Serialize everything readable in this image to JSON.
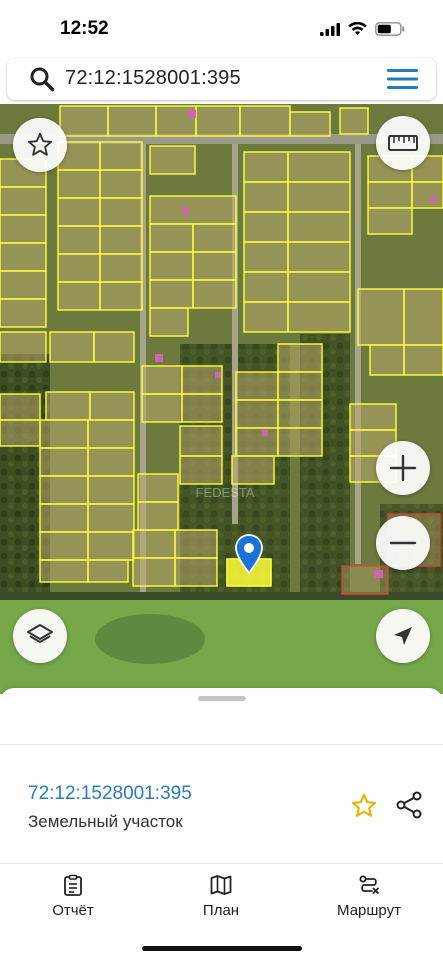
{
  "status": {
    "time": "12:52"
  },
  "search": {
    "query": "72:12:1528001:395"
  },
  "map": {
    "watermark": "FEDESTA",
    "accent": "#1a73d8",
    "parcel_outline": "#ffff3a",
    "buttons": {
      "favorite": "star-outline-icon",
      "ruler": "ruler-icon",
      "zoom_in": "plus-icon",
      "zoom_out": "minus-icon",
      "layers": "layers-icon",
      "locate": "location-arrow-icon"
    }
  },
  "sheet": {
    "parcel_number": "72:12:1528001:395",
    "parcel_type": "Земельный участок"
  },
  "tabs": [
    {
      "label": "Отчёт",
      "icon": "report-icon"
    },
    {
      "label": "План",
      "icon": "map-plan-icon"
    },
    {
      "label": "Маршрут",
      "icon": "route-icon"
    }
  ]
}
